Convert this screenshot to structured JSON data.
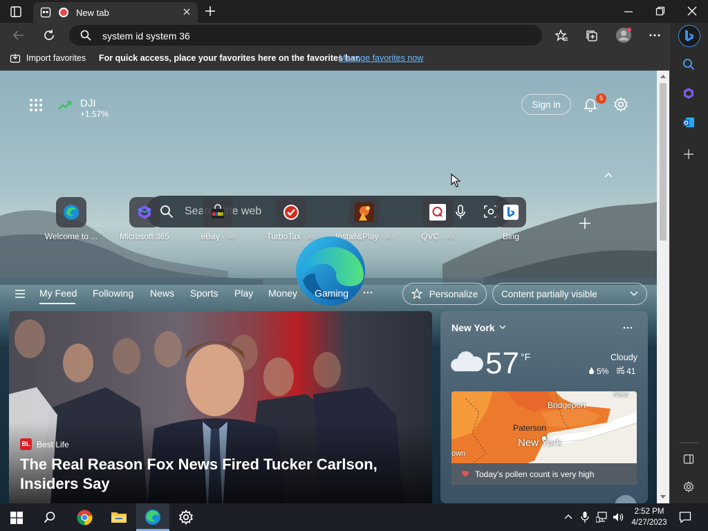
{
  "browser": {
    "tab_title": "New tab",
    "address_text": "system id system 36"
  },
  "favorites_bar": {
    "import_label": "Import favorites",
    "hint": "For quick access, place your favorites here on the favorites bar.",
    "manage_link": "Manage favorites now"
  },
  "header": {
    "ticker_symbol": "DJI",
    "ticker_change": "+1.57%",
    "sign_in": "Sign in",
    "notification_count": "5"
  },
  "search": {
    "placeholder": "Search the web"
  },
  "quick_links": [
    {
      "label": "Welcome to ...",
      "ad": ""
    },
    {
      "label": "Microsoft 365",
      "ad": ""
    },
    {
      "label": "eBay",
      "ad": "Ad"
    },
    {
      "label": "TurboTax",
      "ad": "Ad"
    },
    {
      "label": "Install&Play",
      "ad": "Ad"
    },
    {
      "label": "QVC",
      "ad": "Ad"
    },
    {
      "label": "Bing",
      "ad": ""
    }
  ],
  "feed_nav": {
    "items": [
      "My Feed",
      "Following",
      "News",
      "Sports",
      "Play",
      "Money",
      "Gaming"
    ],
    "personalize": "Personalize",
    "content_visibility": "Content partially visible"
  },
  "news_card": {
    "source": "Best Life",
    "source_badge": "BL",
    "headline": "The Real Reason Fox News Fired Tucker Carlson, Insiders Say"
  },
  "weather": {
    "location": "New York",
    "temperature": "57",
    "unit": "°F",
    "condition": "Cloudy",
    "precipitation": "5%",
    "wind": "41",
    "map_labels": [
      "Bridgeport",
      "Paterson",
      "New York",
      "New",
      "own"
    ],
    "pollen_text": "Today's pollen count is very high"
  },
  "taskbar": {
    "time": "2:52 PM",
    "date": "4/27/2023"
  },
  "colors": {
    "accent_link": "#6cb8ff",
    "ticker_green": "#3fbf5f",
    "notification_badge": "#e0491f"
  }
}
